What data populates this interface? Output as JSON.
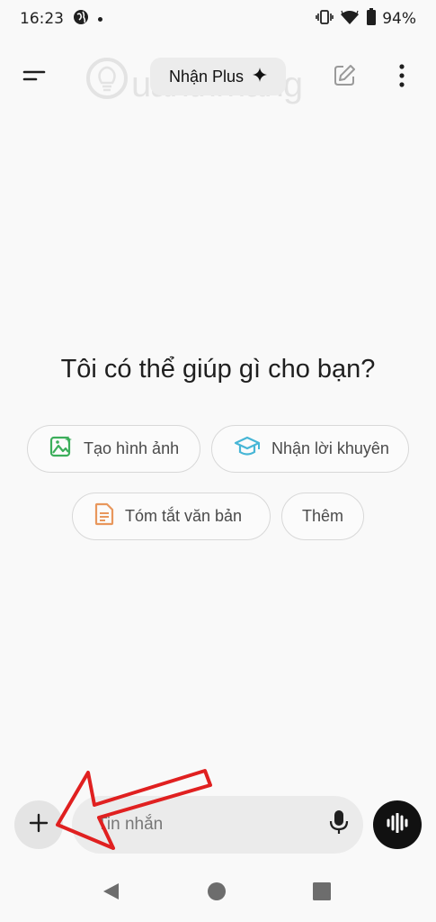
{
  "status_bar": {
    "time": "16:23",
    "battery": "94%",
    "icons": [
      "globe-icon",
      "vibrate-icon",
      "wifi-icon",
      "battery-icon"
    ]
  },
  "top_bar": {
    "menu_icon": "menu-icon",
    "get_plus_label": "Nhận Plus",
    "get_plus_icon": "sparkle-icon",
    "new_chat_icon": "edit-icon",
    "more_icon": "more-vert-icon"
  },
  "watermark": {
    "text": "uantrimang",
    "logo_icon": "bulb-icon"
  },
  "main": {
    "headline": "Tôi có thể giúp gì cho bạn?",
    "suggestions": [
      {
        "label": "Tạo hình ảnh",
        "icon": "image-icon",
        "color": "#3cae5b"
      },
      {
        "label": "Nhận lời khuyên",
        "icon": "graduation-cap-icon",
        "color": "#47b6d6"
      },
      {
        "label": "Tóm tắt văn bản",
        "icon": "document-icon",
        "color": "#e8975c"
      },
      {
        "label": "Thêm",
        "icon": "",
        "color": ""
      }
    ]
  },
  "composer": {
    "attach_icon": "plus-icon",
    "placeholder": "Tin nhắn",
    "mic_icon": "mic-icon",
    "voice_icon": "voice-wave-icon"
  },
  "nav": {
    "back": "back-icon",
    "home": "home-icon",
    "recents": "recents-icon"
  },
  "colors": {
    "background": "#f9f9f9",
    "chip_border": "#d8d8d8",
    "annotation_arrow": "#e02020"
  }
}
